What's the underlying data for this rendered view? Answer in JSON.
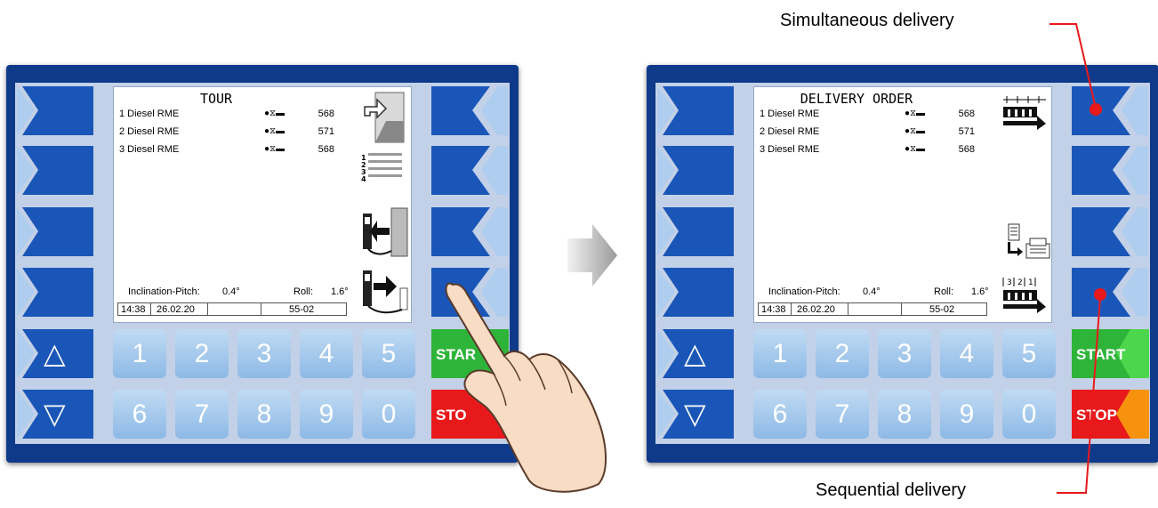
{
  "left_panel": {
    "screen": {
      "title": "TOUR",
      "rows": [
        {
          "name": "1 Diesel RME",
          "status": "●⧖▬",
          "value": "568"
        },
        {
          "name": "2 Diesel RME",
          "status": "●⧖▬",
          "value": "571"
        },
        {
          "name": "3 Diesel RME",
          "status": "●⧖▬",
          "value": "568"
        }
      ],
      "inclination_label": "Inclination-Pitch:",
      "inclination_value": "0.4°",
      "roll_label": "Roll:",
      "roll_value": "1.6°",
      "time": "14:38",
      "date": "26.02.20",
      "code": "55-02"
    },
    "start_label": "STAR",
    "stop_label": "STO"
  },
  "right_panel": {
    "screen": {
      "title": "DELIVERY ORDER",
      "rows": [
        {
          "name": "1 Diesel RME",
          "status": "●⧖▬",
          "value": "568"
        },
        {
          "name": "2 Diesel RME",
          "status": "●⧖▬",
          "value": "571"
        },
        {
          "name": "3 Diesel RME",
          "status": "●⧖▬",
          "value": "568"
        }
      ],
      "inclination_label": "Inclination-Pitch:",
      "inclination_value": "0.4°",
      "roll_label": "Roll:",
      "roll_value": "1.6°",
      "time": "14:38",
      "date": "26.02.20",
      "code": "55-02"
    },
    "start_label": "START",
    "stop_label": "STOP"
  },
  "keypad": {
    "row1": [
      "1",
      "2",
      "3",
      "4",
      "5"
    ],
    "row2": [
      "6",
      "7",
      "8",
      "9",
      "0"
    ],
    "up_symbol": "△",
    "down_symbol": "▽"
  },
  "annotations": {
    "top": "Simultaneous delivery",
    "bottom": "Sequential delivery"
  },
  "colors": {
    "frame": "#0f3a8a",
    "softkey": "#1a56b8",
    "softkey_light": "#aecdef",
    "start": "#2fb43a",
    "stop": "#e8191b",
    "annotation_line": "#e8191b"
  }
}
